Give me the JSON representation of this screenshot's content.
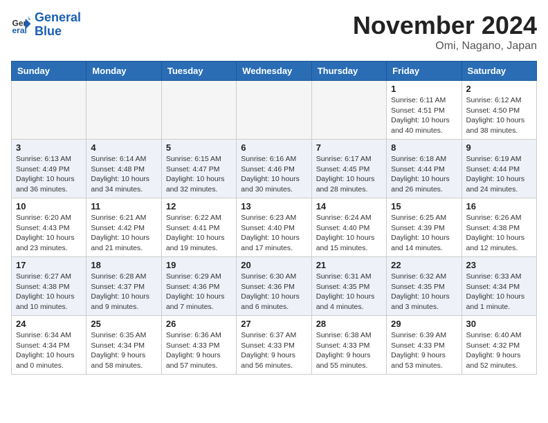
{
  "header": {
    "logo_line1": "General",
    "logo_line2": "Blue",
    "month_title": "November 2024",
    "location": "Omi, Nagano, Japan"
  },
  "weekdays": [
    "Sunday",
    "Monday",
    "Tuesday",
    "Wednesday",
    "Thursday",
    "Friday",
    "Saturday"
  ],
  "weeks": [
    [
      {
        "day": "",
        "empty": true
      },
      {
        "day": "",
        "empty": true
      },
      {
        "day": "",
        "empty": true
      },
      {
        "day": "",
        "empty": true
      },
      {
        "day": "",
        "empty": true
      },
      {
        "day": "1",
        "info": "Sunrise: 6:11 AM\nSunset: 4:51 PM\nDaylight: 10 hours\nand 40 minutes."
      },
      {
        "day": "2",
        "info": "Sunrise: 6:12 AM\nSunset: 4:50 PM\nDaylight: 10 hours\nand 38 minutes."
      }
    ],
    [
      {
        "day": "3",
        "info": "Sunrise: 6:13 AM\nSunset: 4:49 PM\nDaylight: 10 hours\nand 36 minutes."
      },
      {
        "day": "4",
        "info": "Sunrise: 6:14 AM\nSunset: 4:48 PM\nDaylight: 10 hours\nand 34 minutes."
      },
      {
        "day": "5",
        "info": "Sunrise: 6:15 AM\nSunset: 4:47 PM\nDaylight: 10 hours\nand 32 minutes."
      },
      {
        "day": "6",
        "info": "Sunrise: 6:16 AM\nSunset: 4:46 PM\nDaylight: 10 hours\nand 30 minutes."
      },
      {
        "day": "7",
        "info": "Sunrise: 6:17 AM\nSunset: 4:45 PM\nDaylight: 10 hours\nand 28 minutes."
      },
      {
        "day": "8",
        "info": "Sunrise: 6:18 AM\nSunset: 4:44 PM\nDaylight: 10 hours\nand 26 minutes."
      },
      {
        "day": "9",
        "info": "Sunrise: 6:19 AM\nSunset: 4:44 PM\nDaylight: 10 hours\nand 24 minutes."
      }
    ],
    [
      {
        "day": "10",
        "info": "Sunrise: 6:20 AM\nSunset: 4:43 PM\nDaylight: 10 hours\nand 23 minutes."
      },
      {
        "day": "11",
        "info": "Sunrise: 6:21 AM\nSunset: 4:42 PM\nDaylight: 10 hours\nand 21 minutes."
      },
      {
        "day": "12",
        "info": "Sunrise: 6:22 AM\nSunset: 4:41 PM\nDaylight: 10 hours\nand 19 minutes."
      },
      {
        "day": "13",
        "info": "Sunrise: 6:23 AM\nSunset: 4:40 PM\nDaylight: 10 hours\nand 17 minutes."
      },
      {
        "day": "14",
        "info": "Sunrise: 6:24 AM\nSunset: 4:40 PM\nDaylight: 10 hours\nand 15 minutes."
      },
      {
        "day": "15",
        "info": "Sunrise: 6:25 AM\nSunset: 4:39 PM\nDaylight: 10 hours\nand 14 minutes."
      },
      {
        "day": "16",
        "info": "Sunrise: 6:26 AM\nSunset: 4:38 PM\nDaylight: 10 hours\nand 12 minutes."
      }
    ],
    [
      {
        "day": "17",
        "info": "Sunrise: 6:27 AM\nSunset: 4:38 PM\nDaylight: 10 hours\nand 10 minutes."
      },
      {
        "day": "18",
        "info": "Sunrise: 6:28 AM\nSunset: 4:37 PM\nDaylight: 10 hours\nand 9 minutes."
      },
      {
        "day": "19",
        "info": "Sunrise: 6:29 AM\nSunset: 4:36 PM\nDaylight: 10 hours\nand 7 minutes."
      },
      {
        "day": "20",
        "info": "Sunrise: 6:30 AM\nSunset: 4:36 PM\nDaylight: 10 hours\nand 6 minutes."
      },
      {
        "day": "21",
        "info": "Sunrise: 6:31 AM\nSunset: 4:35 PM\nDaylight: 10 hours\nand 4 minutes."
      },
      {
        "day": "22",
        "info": "Sunrise: 6:32 AM\nSunset: 4:35 PM\nDaylight: 10 hours\nand 3 minutes."
      },
      {
        "day": "23",
        "info": "Sunrise: 6:33 AM\nSunset: 4:34 PM\nDaylight: 10 hours\nand 1 minute."
      }
    ],
    [
      {
        "day": "24",
        "info": "Sunrise: 6:34 AM\nSunset: 4:34 PM\nDaylight: 10 hours\nand 0 minutes."
      },
      {
        "day": "25",
        "info": "Sunrise: 6:35 AM\nSunset: 4:34 PM\nDaylight: 9 hours\nand 58 minutes."
      },
      {
        "day": "26",
        "info": "Sunrise: 6:36 AM\nSunset: 4:33 PM\nDaylight: 9 hours\nand 57 minutes."
      },
      {
        "day": "27",
        "info": "Sunrise: 6:37 AM\nSunset: 4:33 PM\nDaylight: 9 hours\nand 56 minutes."
      },
      {
        "day": "28",
        "info": "Sunrise: 6:38 AM\nSunset: 4:33 PM\nDaylight: 9 hours\nand 55 minutes."
      },
      {
        "day": "29",
        "info": "Sunrise: 6:39 AM\nSunset: 4:33 PM\nDaylight: 9 hours\nand 53 minutes."
      },
      {
        "day": "30",
        "info": "Sunrise: 6:40 AM\nSunset: 4:32 PM\nDaylight: 9 hours\nand 52 minutes."
      }
    ]
  ]
}
